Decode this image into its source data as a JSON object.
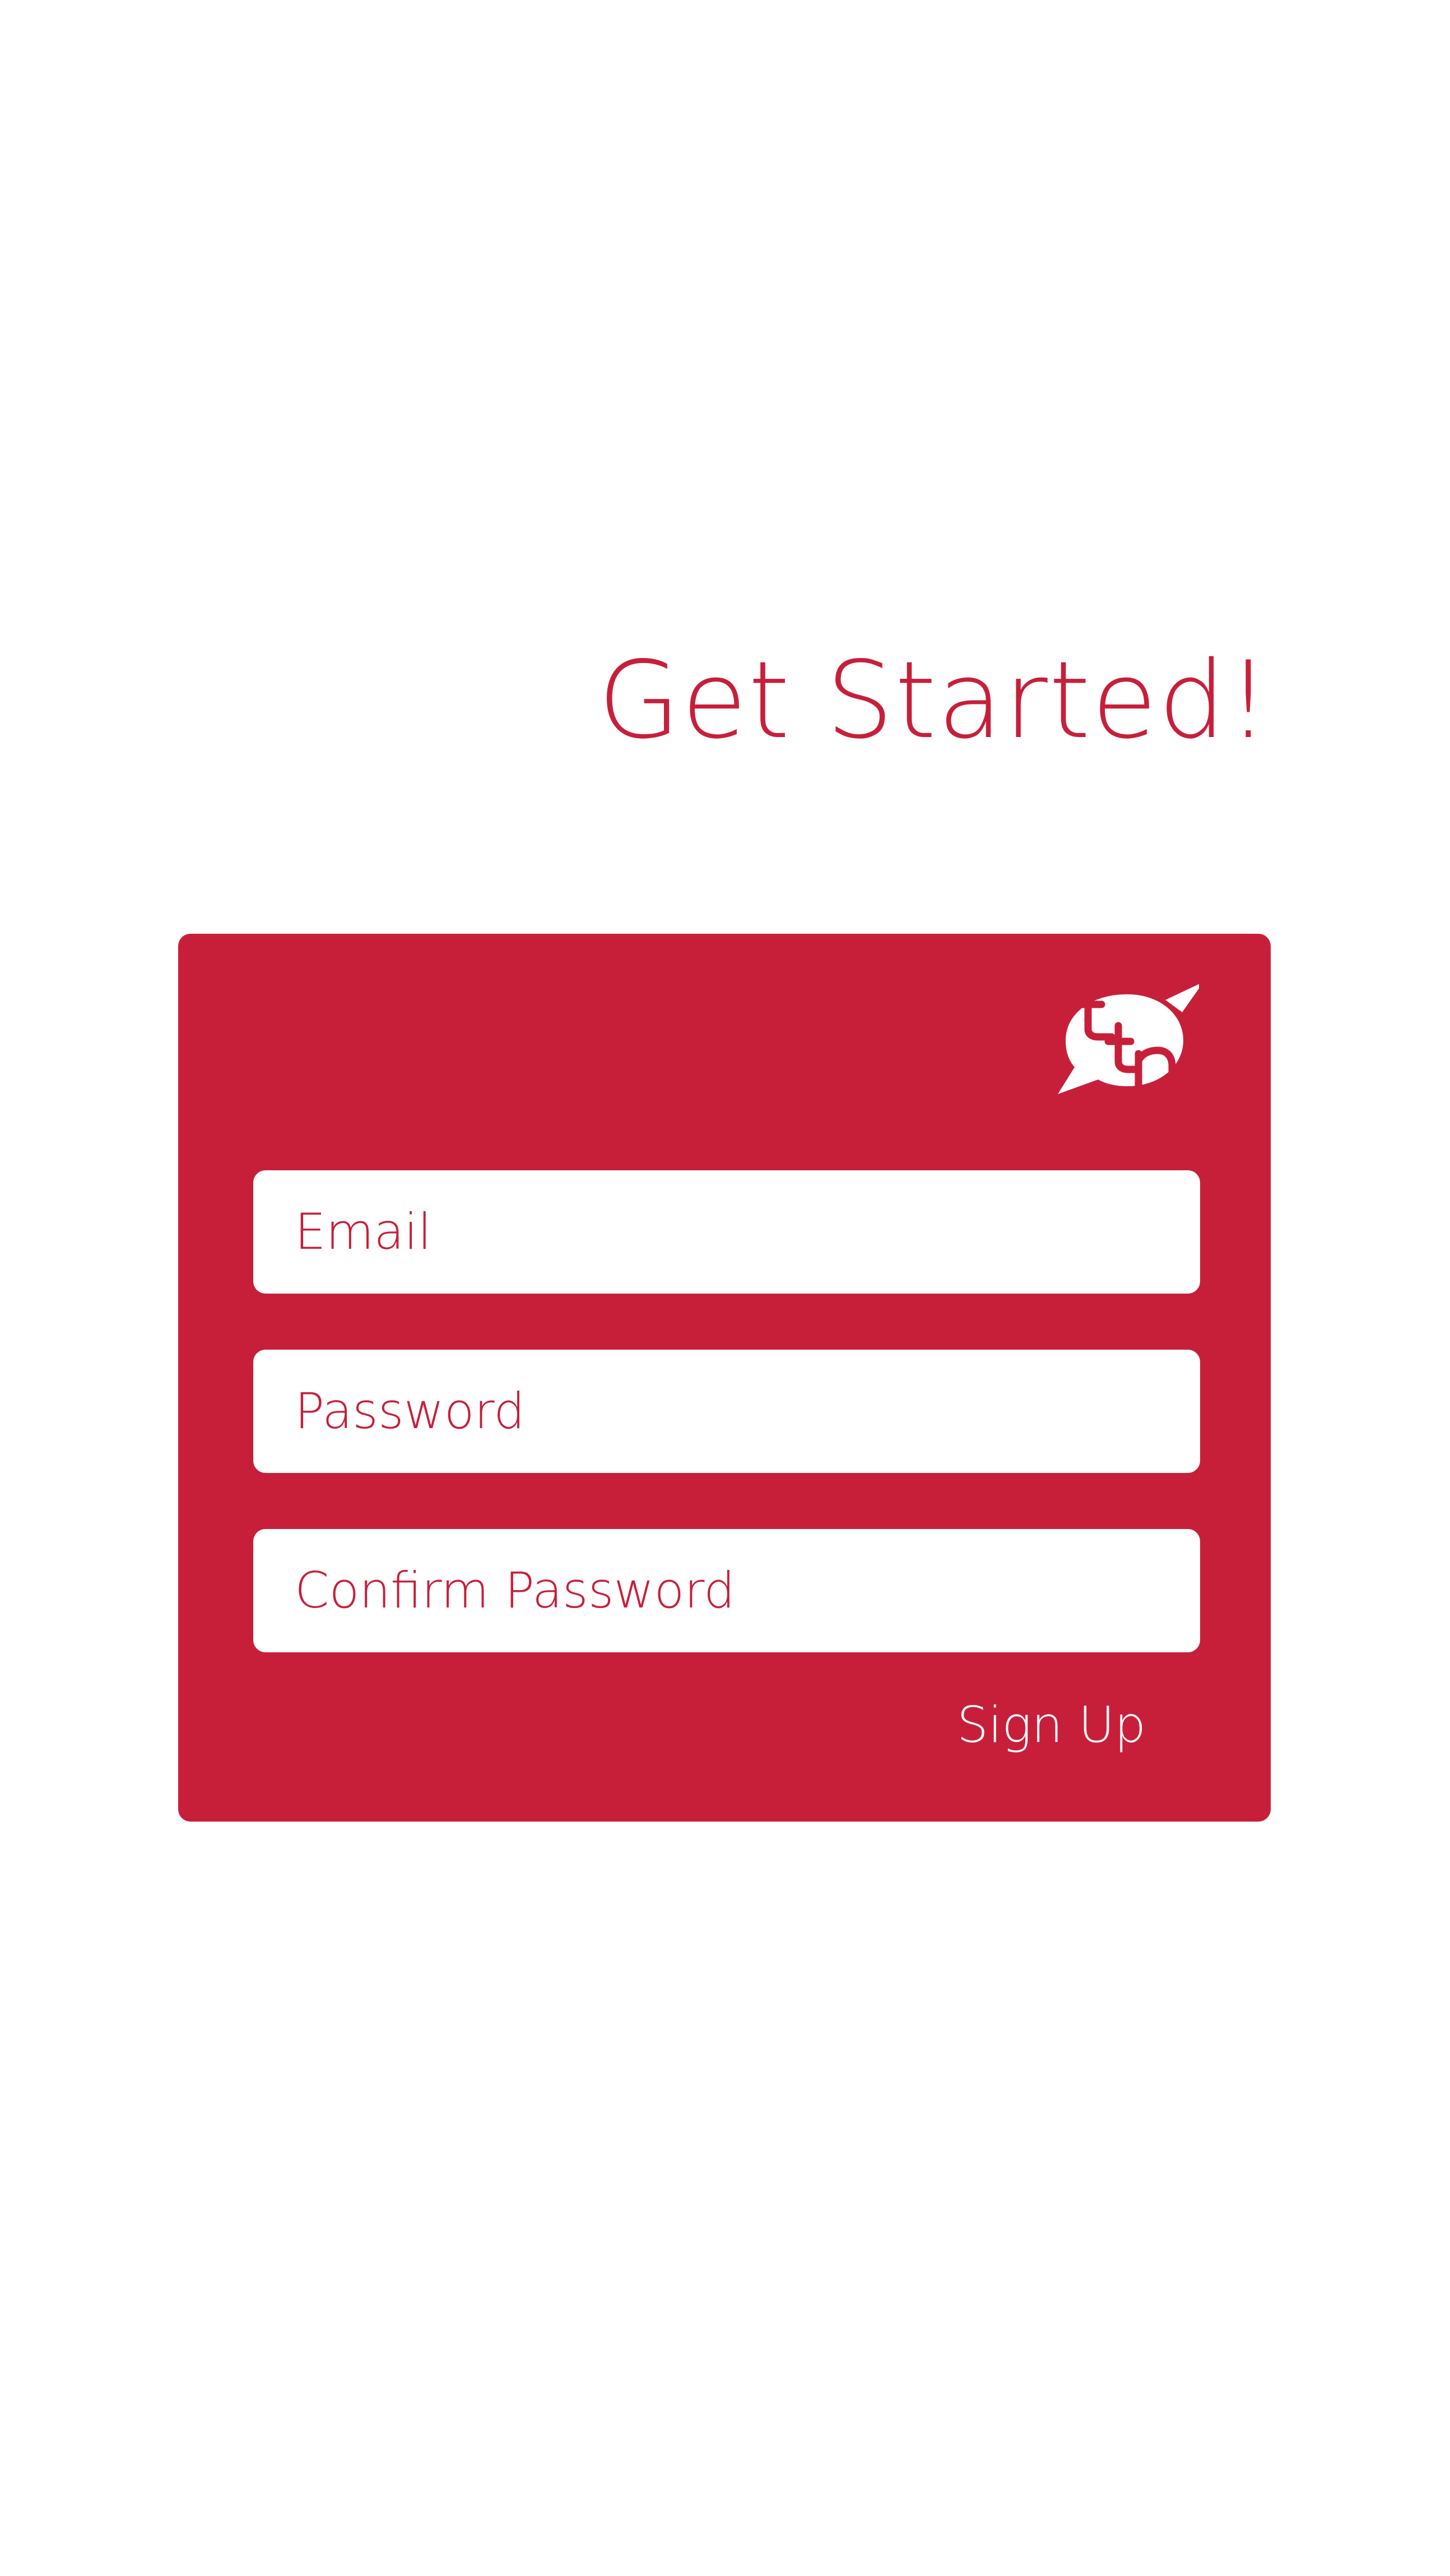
{
  "theme": {
    "accent": "#c71f3a",
    "background": "#ffffff",
    "on_accent": "#ffffff"
  },
  "header": {
    "title": "Get Started!"
  },
  "form": {
    "logo_icon": "ttn-speech-bubble-logo",
    "email": {
      "placeholder": "Email",
      "value": ""
    },
    "password": {
      "placeholder": "Password",
      "value": ""
    },
    "confirm_password": {
      "placeholder": "Confirm Password",
      "value": ""
    },
    "signup_label": "Sign Up"
  }
}
